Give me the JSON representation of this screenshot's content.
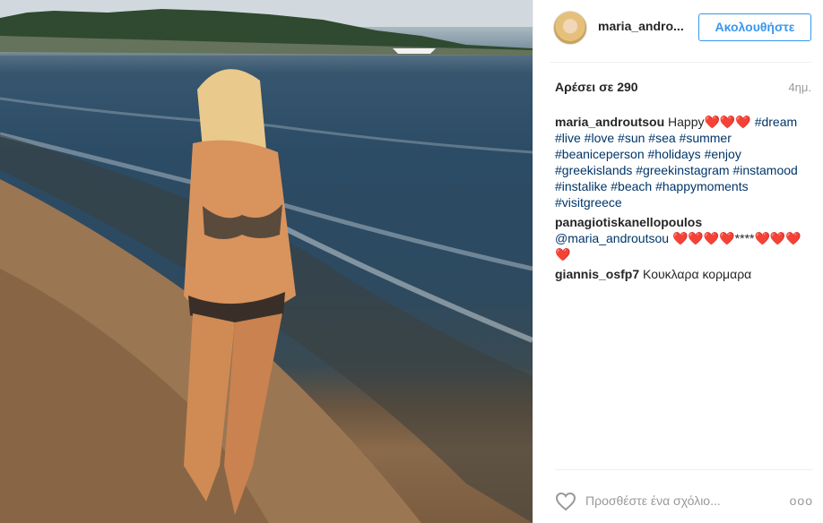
{
  "post": {
    "username": "maria_andro...",
    "follow_label": "Ακολουθήστε",
    "likes_label": "Αρέσει σε 290",
    "time_ago": "4ημ."
  },
  "comments": [
    {
      "author": "maria_androutsou",
      "text": "Happy❤️❤️❤️",
      "tags": "#dream #live #love #sun #sea #summer #beaniceperson #holidays #enjoy #greekislands #greekinstagram #instamood #instalike #beach #happymoments #visitgreece"
    },
    {
      "author": "panagiotiskanellopoulos",
      "mention": "@maria_androutsou",
      "text": "❤️❤️❤️❤️****❤️❤️❤️❤️"
    },
    {
      "author": "giannis_osfp7",
      "text": "Κουκλαρα κορμαρα"
    }
  ],
  "footer": {
    "heart_icon": "heart-outline-icon",
    "add_comment_placeholder": "Προσθέστε ένα σχόλιο...",
    "more_label": "ooo"
  }
}
